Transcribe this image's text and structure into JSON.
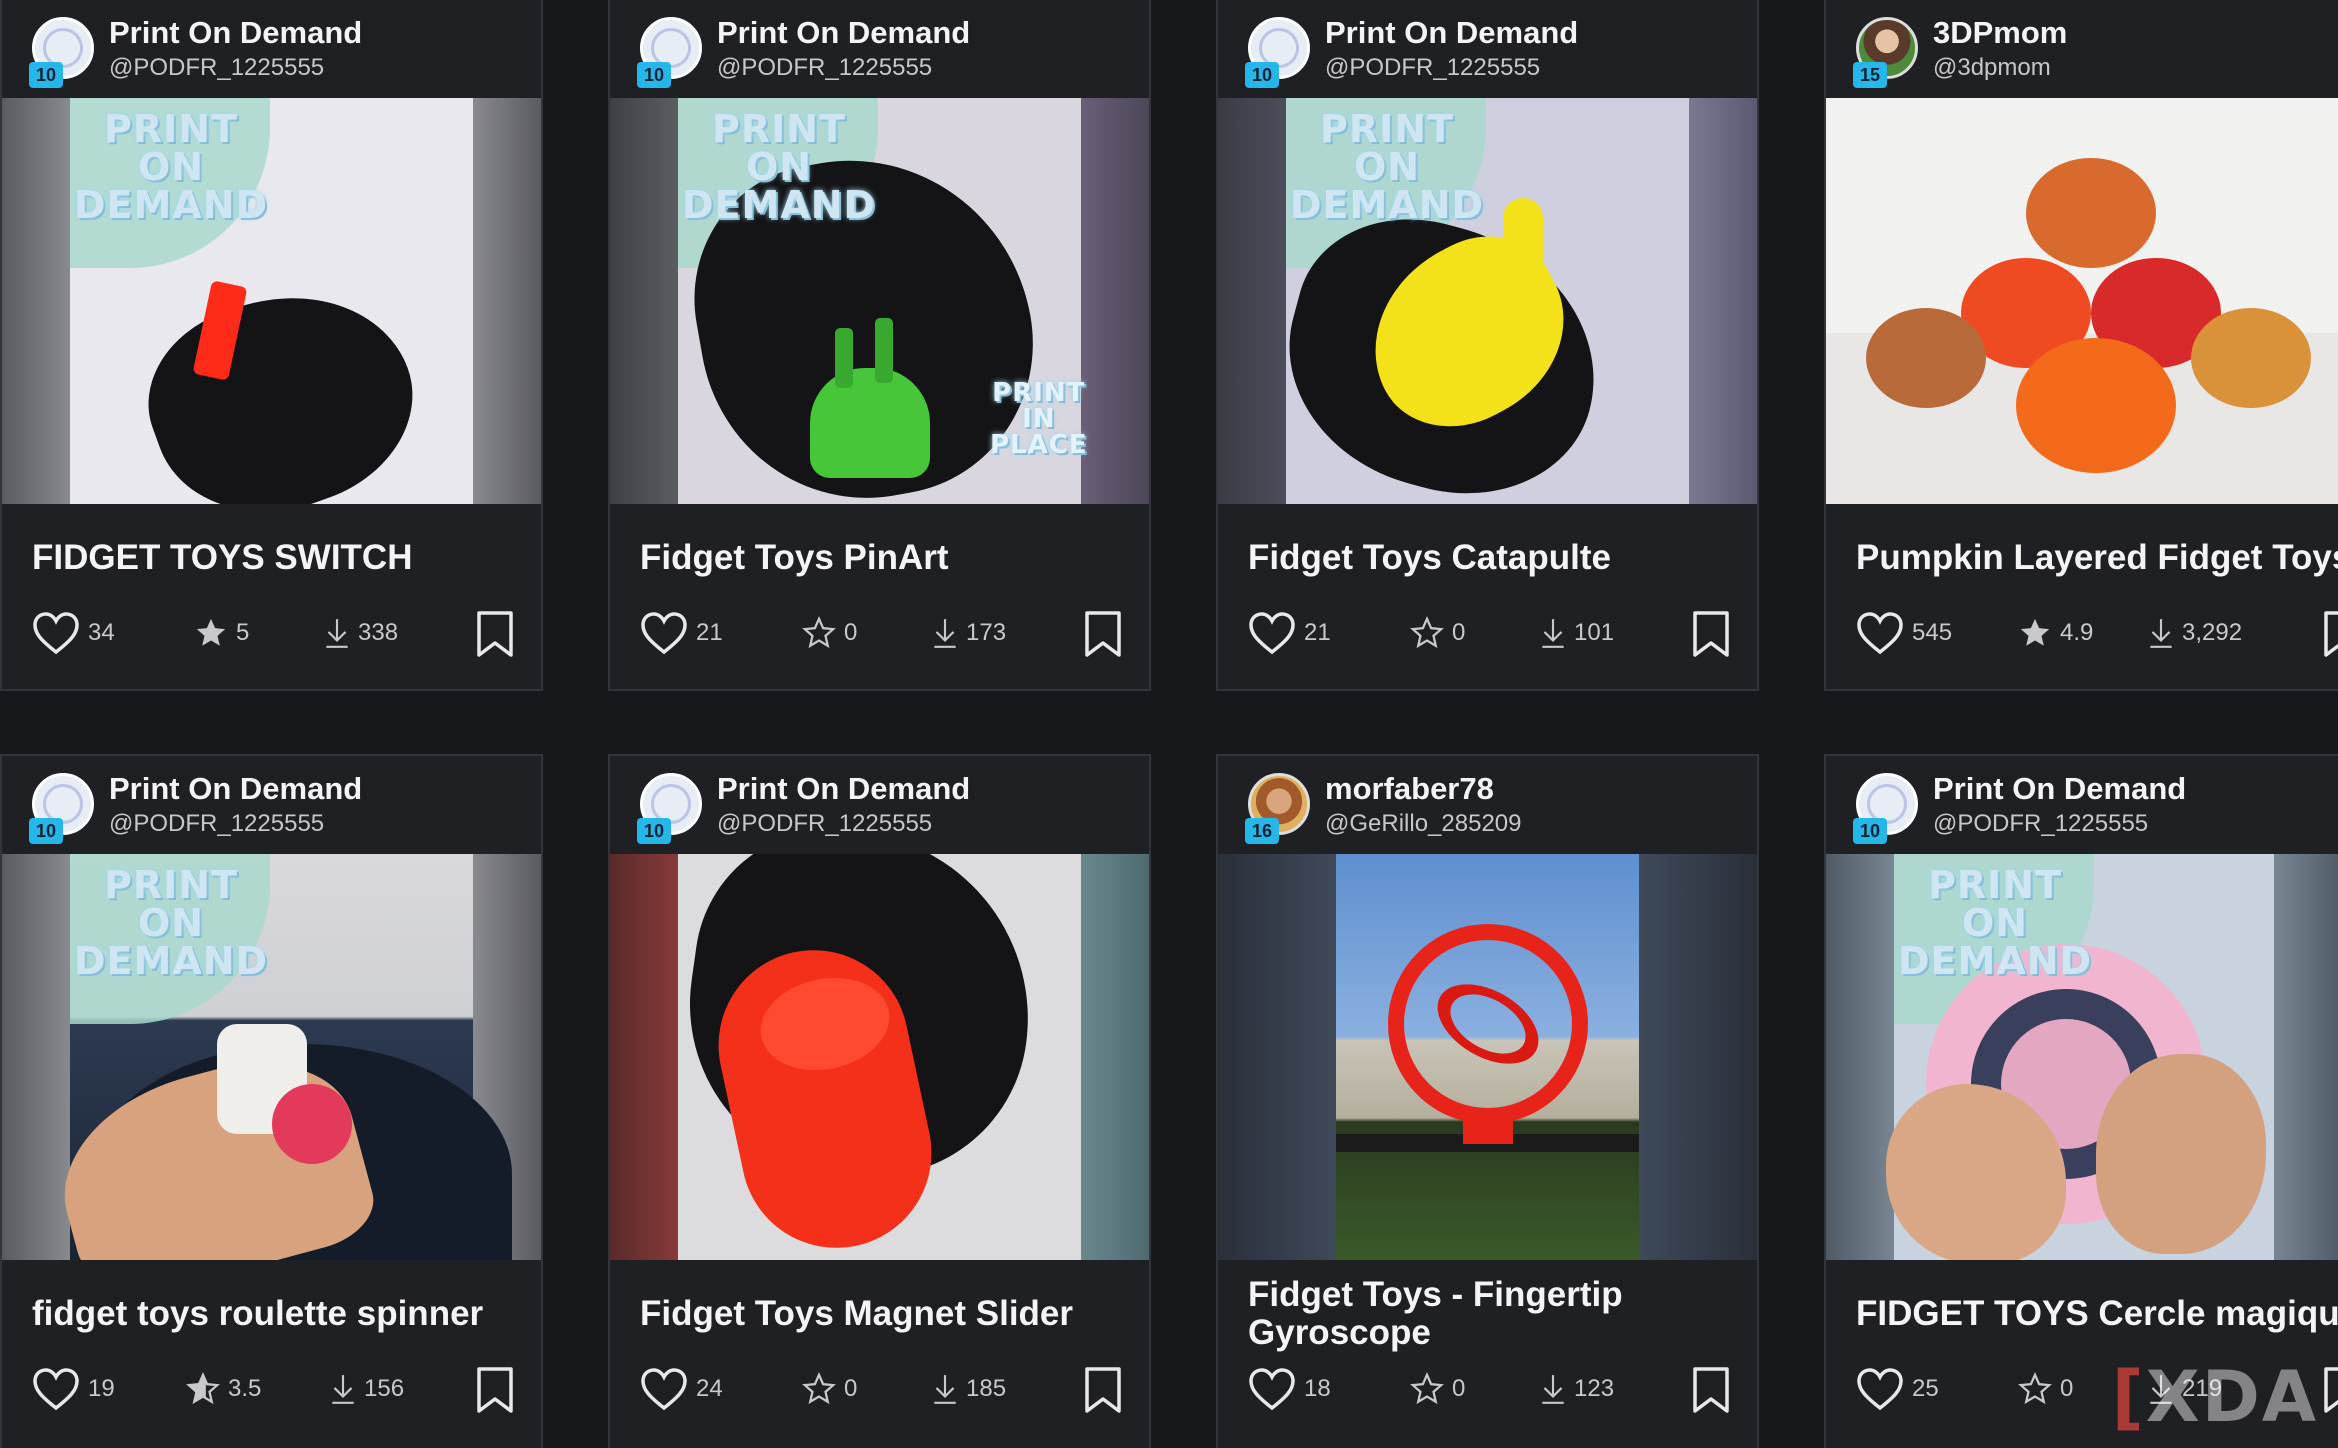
{
  "cards": [
    {
      "author": "Print On Demand",
      "handle": "@PODFR_1225555",
      "level": "10",
      "title": "FIDGET TOYS SWITCH",
      "likes": "34",
      "rating": "5",
      "rating_filled": true,
      "downloads": "338",
      "logo_text": "PRINT ON DEMAND"
    },
    {
      "author": "Print On Demand",
      "handle": "@PODFR_1225555",
      "level": "10",
      "title": "Fidget Toys PinArt",
      "likes": "21",
      "rating": "0",
      "rating_filled": false,
      "downloads": "173",
      "logo_text": "PRINT ON DEMAND",
      "corner_text": "PRINT IN PLACE"
    },
    {
      "author": "Print On Demand",
      "handle": "@PODFR_1225555",
      "level": "10",
      "title": "Fidget Toys Catapulte",
      "likes": "21",
      "rating": "0",
      "rating_filled": false,
      "downloads": "101",
      "logo_text": "PRINT ON DEMAND"
    },
    {
      "author": "3DPmom",
      "handle": "@3dpmom",
      "level": "15",
      "title": "Pumpkin Layered Fidget Toys",
      "likes": "545",
      "rating": "4.9",
      "rating_filled": true,
      "downloads": "3,292"
    },
    {
      "author": "Print On Demand",
      "handle": "@PODFR_1225555",
      "level": "10",
      "title": "fidget toys roulette spinner",
      "likes": "19",
      "rating": "3.5",
      "rating_filled": true,
      "downloads": "156",
      "logo_text": "PRINT ON DEMAND"
    },
    {
      "author": "Print On Demand",
      "handle": "@PODFR_1225555",
      "level": "10",
      "title": "Fidget Toys Magnet Slider",
      "likes": "24",
      "rating": "0",
      "rating_filled": false,
      "downloads": "185"
    },
    {
      "author": "morfaber78",
      "handle": "@GeRillo_285209",
      "level": "16",
      "title": "Fidget Toys - Fingertip Gyroscope",
      "likes": "18",
      "rating": "0",
      "rating_filled": false,
      "downloads": "123"
    },
    {
      "author": "Print On Demand",
      "handle": "@PODFR_1225555",
      "level": "10",
      "title": "FIDGET TOYS Cercle magique",
      "likes": "25",
      "rating": "0",
      "rating_filled": false,
      "downloads": "219",
      "logo_text": "PRINT ON DEMAND"
    }
  ],
  "watermark": "XDA",
  "colors": {
    "background": "#17181b",
    "card": "#1f2023",
    "level_badge": "#25b7ea"
  },
  "icons": [
    "heart-icon",
    "star-icon",
    "download-icon",
    "bookmark-icon"
  ]
}
